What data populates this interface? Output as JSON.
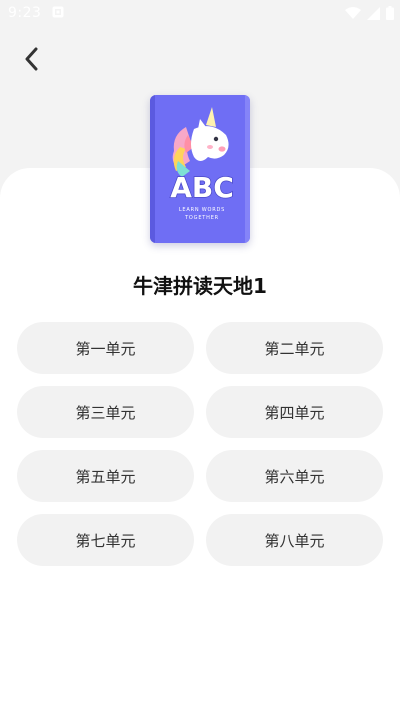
{
  "status_bar": {
    "time": "9:23",
    "icons": [
      "notification-icon",
      "wifi-icon",
      "signal-icon",
      "battery-icon"
    ]
  },
  "header": {
    "back_icon": "back-arrow-icon"
  },
  "book": {
    "title": "牛津拼读天地1",
    "cover": {
      "main_text": "ABC",
      "sub_text_1": "LEARN WORDS",
      "sub_text_2": "TOGETHER",
      "background": "#6f6ef4"
    }
  },
  "units": [
    {
      "label": "第一单元"
    },
    {
      "label": "第二单元"
    },
    {
      "label": "第三单元"
    },
    {
      "label": "第四单元"
    },
    {
      "label": "第五单元"
    },
    {
      "label": "第六单元"
    },
    {
      "label": "第七单元"
    },
    {
      "label": "第八单元"
    }
  ],
  "colors": {
    "page_background": "#f3f3f3",
    "sheet_background": "#ffffff",
    "unit_button_background": "#f2f2f2",
    "title_text": "#111111",
    "cover_background": "#6f6ef4"
  }
}
